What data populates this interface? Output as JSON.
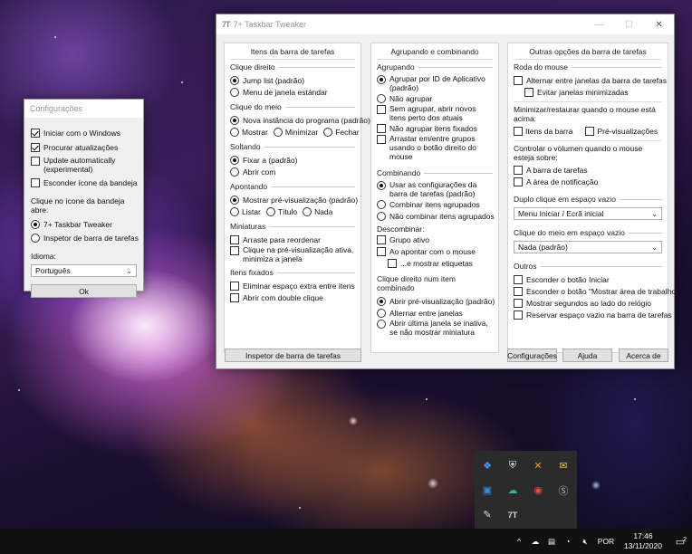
{
  "config_window": {
    "title": "Configurações",
    "options": [
      {
        "label": "Iniciar com o Windows",
        "checked": true
      },
      {
        "label": "Procurar atualizações",
        "checked": true
      },
      {
        "label": "Update automatically (experimental)",
        "checked": false
      },
      {
        "label": "Esconder ícone da bandeja",
        "checked": false
      }
    ],
    "tray_click_label": "Clique no ícone da bandeja abre:",
    "tray_click_options": [
      {
        "label": "7+ Taskbar Tweaker",
        "selected": true
      },
      {
        "label": "Inspetor de barra de tarefas",
        "selected": false
      }
    ],
    "language_label": "Idioma:",
    "language_value": "Português",
    "ok_label": "Ok"
  },
  "main_window": {
    "title": "7+ Taskbar Tweaker",
    "app_icon_text": "7T",
    "col1": {
      "header": "Itens da barra de tarefas",
      "right_click": {
        "label": "Clique direito",
        "options": [
          {
            "label": "Jump list (padrão)",
            "selected": true
          },
          {
            "label": "Menu de janela estándar",
            "selected": false
          }
        ]
      },
      "middle_click": {
        "label": "Clique do meio",
        "options": [
          {
            "label": "Nova instância do programa (padrão)",
            "selected": true
          },
          {
            "label": "Mostrar",
            "selected": false
          },
          {
            "label": "Minimizar",
            "selected": false
          },
          {
            "label": "Fechar",
            "selected": false
          }
        ]
      },
      "drop": {
        "label": "Soltando",
        "options": [
          {
            "label": "Fixar a (padrão)",
            "selected": true
          },
          {
            "label": "Abrir com",
            "selected": false
          }
        ]
      },
      "hover": {
        "label": "Apontando",
        "options": [
          {
            "label": "Mostrar pré-visualização (padrão)",
            "selected": true
          },
          {
            "label": "Listar",
            "selected": false
          },
          {
            "label": "Título",
            "selected": false
          },
          {
            "label": "Nada",
            "selected": false
          }
        ]
      },
      "thumbnails": {
        "label": "Miniaturas",
        "options": [
          {
            "label": "Arraste para reordenar",
            "checked": false
          },
          {
            "label": "Clique na pré-visualização ativa, minimiza a janela",
            "checked": false
          }
        ]
      },
      "pinned": {
        "label": "Itens fixados",
        "options": [
          {
            "label": "Eliminar espaço extra entre itens",
            "checked": false
          },
          {
            "label": "Abrir com double clique",
            "checked": false
          }
        ]
      },
      "inspector_button": "Inspetor de barra de tarefas"
    },
    "col2": {
      "header": "Agrupando e combinando",
      "grouping": {
        "label": "Agrupando",
        "options": [
          {
            "label": "Agrupar por ID de Aplicativo (padrão)",
            "selected": true
          },
          {
            "label": "Não agrupar",
            "selected": false
          }
        ],
        "checks": [
          {
            "label": "Sem agrupar, abrir novos itens perto dos atuais",
            "checked": false
          },
          {
            "label": "Não agrupar itens fixados",
            "checked": false
          },
          {
            "label": "Arrastar em/entre grupos usando o botão direito do mouse",
            "checked": false
          }
        ]
      },
      "combining": {
        "label": "Combinando",
        "options": [
          {
            "label": "Usar as configurações da barra de tarefas (padrão)",
            "selected": true
          },
          {
            "label": "Combinar itens agrupados",
            "selected": false
          },
          {
            "label": "Não combinar itens agrupados",
            "selected": false
          }
        ]
      },
      "decombining": {
        "label": "Descombinar:",
        "checks": [
          {
            "label": "Grupo ativo",
            "checked": false
          },
          {
            "label": "Ao apontar com o mouse",
            "checked": false
          },
          {
            "label": "...e mostrar etiquetas",
            "checked": false
          }
        ]
      },
      "right_click_combined": {
        "label": "Clique direito num item combinado",
        "options": [
          {
            "label": "Abrir pré-visualização (padrão)",
            "selected": true
          },
          {
            "label": "Alternar entre janelas",
            "selected": false
          },
          {
            "label": "Abrir última janela se inativa, se não mostrar miniatura",
            "selected": false
          }
        ]
      }
    },
    "col3": {
      "header": "Outras opções da barra de tarefas",
      "wheel": {
        "label": "Roda do mouse",
        "checks": [
          {
            "label": "Alternar entre janelas da barra de tarefas",
            "checked": false
          },
          {
            "label": "Evitar janelas minimizadas",
            "checked": false
          }
        ]
      },
      "minimize_label": "Minimizar/restaurar quando o mouse está acima:",
      "minimize_checks": [
        {
          "label": "Itens da barra",
          "checked": false
        },
        {
          "label": "Pré-visualizações",
          "checked": false
        }
      ],
      "volume_label": "Controlar o volumen quando o mouse esteja sobre:",
      "volume_checks": [
        {
          "label": "A barra de tarefas",
          "checked": false
        },
        {
          "label": "A área de notificação",
          "checked": false
        }
      ],
      "double_click": {
        "label": "Duplo clique em espaço vazio",
        "value": "Menu Iniciar / Ecrã inicial"
      },
      "middle_click": {
        "label": "Clique do meio em espaço vazio",
        "value": "Nada (padrão)"
      },
      "others": {
        "label": "Outros",
        "checks": [
          {
            "label": "Esconder o botão Iniciar",
            "checked": false
          },
          {
            "label": "Esconder o botão \"Mostrar área de trabalho\"",
            "checked": false
          },
          {
            "label": "Mostrar segundos ao lado do relógio",
            "checked": false
          },
          {
            "label": "Reservar espaço vazio na barra de tarefas",
            "checked": false
          }
        ]
      }
    },
    "buttons": {
      "settings": "Configurações",
      "help": "Ajuda",
      "about": "Acerca de"
    }
  },
  "taskbar": {
    "language": "POR",
    "time": "17:46",
    "date": "13/11/2020",
    "notification_count": "2",
    "tray_popup_icons": [
      "dropbox-icon",
      "shield-icon",
      "tool-icon",
      "mail-icon",
      "outlook-icon",
      "cloud-sync-icon",
      "chrome-icon",
      "skype-icon",
      "pen-icon",
      "taskbar-tweaker-icon"
    ]
  }
}
